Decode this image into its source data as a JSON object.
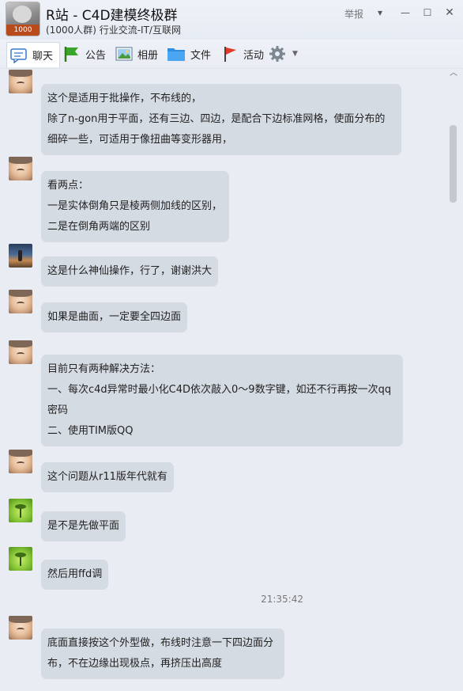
{
  "window": {
    "group_name": "R站 - C4D建模终极群",
    "group_subtitle": "(1000人群) 行业交流-IT/互联网",
    "avatar_badge": "1000",
    "report_label": "举报",
    "controls": {
      "dropdown": "▾",
      "minimize": "—",
      "maximize": "☐",
      "close": "✕"
    }
  },
  "tabs": [
    {
      "label": "聊天",
      "icon": "chat-icon"
    },
    {
      "label": "公告",
      "icon": "flag-icon"
    },
    {
      "label": "相册",
      "icon": "photo-icon"
    },
    {
      "label": "文件",
      "icon": "folder-icon"
    },
    {
      "label": "活动",
      "icon": "pin-flag-icon"
    },
    {
      "label": "",
      "icon": "gear-icon"
    }
  ],
  "messages": [
    {
      "avatar": "baby",
      "lines": [
        "这个是适用于批操作，不布线的，",
        "除了n-gon用于平面，还有三边、四边，是配合下边标准网格，使面分布的",
        "细碎一些，可适用于像扭曲等变形器用，"
      ]
    },
    {
      "avatar": "baby",
      "lines": [
        "看两点：",
        "一是实体倒角只是棱两侧加线的区别，",
        "二是在倒角两端的区别"
      ]
    },
    {
      "avatar": "mountain",
      "lines": [
        "这是什么神仙操作，行了，谢谢洪大"
      ]
    },
    {
      "avatar": "baby",
      "lines": [
        "如果是曲面，一定要全四边面"
      ]
    },
    {
      "avatar": "baby",
      "lines": [
        "目前只有两种解决方法：",
        "一、每次c4d异常时最小化C4D依次敲入0～9数字键，如还不行再按一次qq",
        "密码",
        "二、使用TIM版QQ"
      ]
    },
    {
      "avatar": "baby",
      "lines": [
        "这个问题从r11版年代就有"
      ]
    },
    {
      "avatar": "sprout",
      "lines": [
        "是不是先做平面"
      ]
    },
    {
      "avatar": "sprout",
      "lines": [
        "然后用ffd调"
      ]
    },
    {
      "avatar": "baby",
      "lines": [
        "底面直接按这个外型做，布线时注意一下四边面分",
        "布，不在边缘出现极点，再挤压出高度"
      ]
    }
  ],
  "timestamp": "21:35:42"
}
